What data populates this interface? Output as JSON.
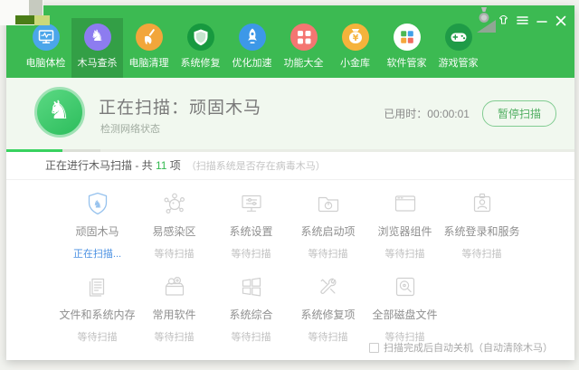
{
  "window_controls": {
    "medal_icon": "medal",
    "skin_icon": "t-shirt-skin",
    "menu_icon": "hamburger-menu",
    "minimize_icon": "minimize",
    "close_icon": "close"
  },
  "nav": {
    "tabs": [
      {
        "label": "电脑体检",
        "icon": "computer-checkup-icon",
        "color": "#4ba6ea",
        "selected": false
      },
      {
        "label": "木马查杀",
        "icon": "trojan-scan-horse-icon",
        "color": "#8d7cf0",
        "selected": true
      },
      {
        "label": "电脑清理",
        "icon": "cleanup-broom-icon",
        "color": "#f2a63b",
        "selected": false
      },
      {
        "label": "系统修复",
        "icon": "system-repair-shield-icon",
        "color": "#17993f",
        "selected": false
      },
      {
        "label": "优化加速",
        "icon": "speedup-rocket-icon",
        "color": "#3d98e8",
        "selected": false
      },
      {
        "label": "功能大全",
        "icon": "toolbox-grid-icon",
        "color": "#f47672",
        "selected": false
      },
      {
        "label": "小金库",
        "icon": "money-vault-icon",
        "color": "#f5b33b",
        "selected": false
      },
      {
        "label": "软件管家",
        "icon": "software-manager-icon",
        "color": "#ffffff",
        "selected": false
      },
      {
        "label": "游戏管家",
        "icon": "game-manager-icon",
        "color": "#1f9b47",
        "selected": false
      }
    ]
  },
  "scan_header": {
    "title": "正在扫描：顽固木马",
    "subtitle": "检测网络状态",
    "elapsed": "已用时：00:00:01",
    "pause_button": "暂停扫描"
  },
  "status_bar": {
    "text_prefix": "正在进行木马扫描 - 共 ",
    "count": "11",
    "text_suffix": " 项",
    "note": "（扫描系统是否存在病毒木马）"
  },
  "scan_items": [
    {
      "label": "顽固木马",
      "status": "正在扫描...",
      "state": "scanning",
      "icon": "shield-horse-icon"
    },
    {
      "label": "易感染区",
      "status": "等待扫描",
      "state": "waiting",
      "icon": "virus-icon"
    },
    {
      "label": "系统设置",
      "status": "等待扫描",
      "state": "waiting",
      "icon": "monitor-settings-icon"
    },
    {
      "label": "系统启动项",
      "status": "等待扫描",
      "state": "waiting",
      "icon": "startup-folder-icon"
    },
    {
      "label": "浏览器组件",
      "status": "等待扫描",
      "state": "waiting",
      "icon": "browser-window-icon"
    },
    {
      "label": "系统登录和服务",
      "status": "等待扫描",
      "state": "waiting",
      "icon": "id-badge-icon"
    },
    {
      "label": "文件和系统内存",
      "status": "等待扫描",
      "state": "waiting",
      "icon": "documents-icon"
    },
    {
      "label": "常用软件",
      "status": "等待扫描",
      "state": "waiting",
      "icon": "software-box-icon"
    },
    {
      "label": "系统综合",
      "status": "等待扫描",
      "state": "waiting",
      "icon": "windows-logo-icon"
    },
    {
      "label": "系统修复项",
      "status": "等待扫描",
      "state": "waiting",
      "icon": "repair-tools-icon"
    },
    {
      "label": "全部磁盘文件",
      "status": "等待扫描",
      "state": "waiting",
      "icon": "disk-search-icon"
    }
  ],
  "footer": {
    "auto_shutdown_label": "扫描完成后自动关机（自动清除木马）",
    "checked": false
  },
  "colors": {
    "header_green": "#3cba52",
    "selected_tab_green": "#339f46",
    "accent_green": "#33b950",
    "progress_green": "#38d25f",
    "active_status_blue": "#4a90e2",
    "scan_band_bg": "#f1f8ef"
  }
}
